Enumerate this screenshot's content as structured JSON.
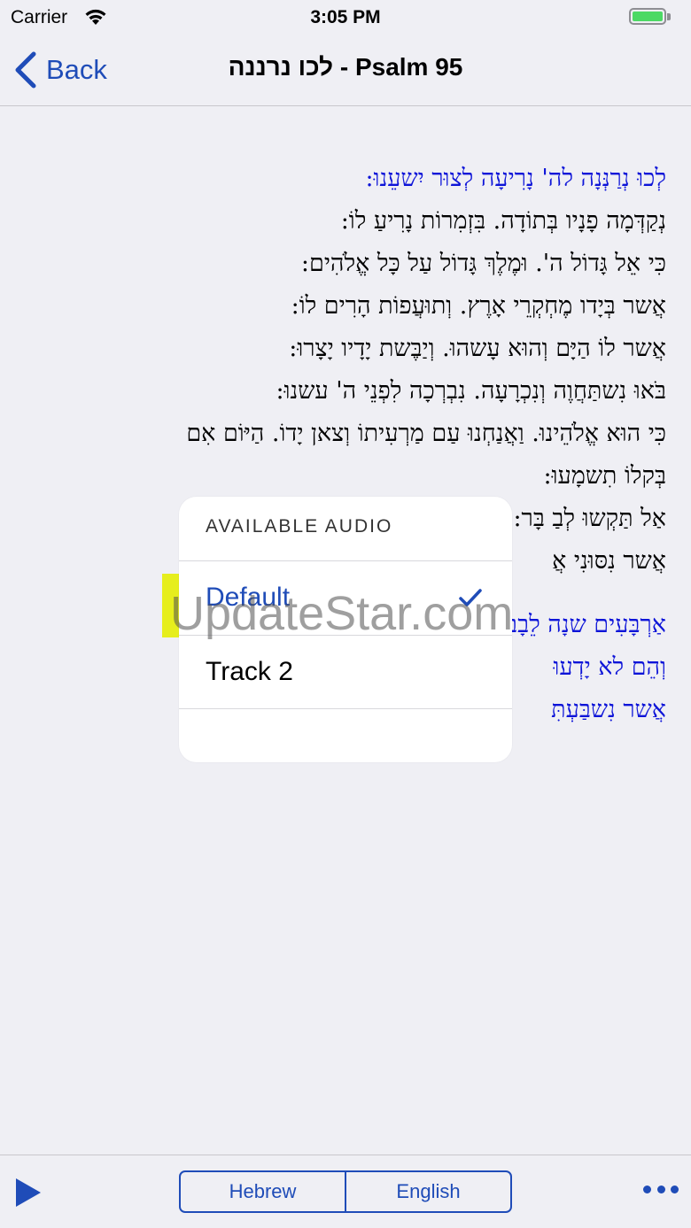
{
  "status_bar": {
    "carrier": "Carrier",
    "time": "3:05 PM",
    "battery_level": 1.0
  },
  "nav": {
    "back_label": "Back",
    "title": "לכו נרננה - Psalm 95"
  },
  "psalm": {
    "lines": [
      {
        "text": "לְכוּ נְרַנְּנָה לה' נָרִיעָה לְצוּר יִשעֵנוּ:",
        "highlighted": true
      },
      {
        "text": "נְקַדְּמָה פָנָיו בְּתוֹדָה. בִּזְמִרוֹת נָרִיעַ לוֹ:",
        "highlighted": false
      },
      {
        "text": "כִּי אֵל גָּדוֹל ה'. וּמֶלֶךְ גָּדוֹל עַל כָּל אֱלֹהִים:",
        "highlighted": false
      },
      {
        "text": "אֲשר בְּיָדו מֶחְקְרֵי אָרֶץ. וְתוּעֲפוֹת הָרִים לוֹ:",
        "highlighted": false
      },
      {
        "text": "אֲשר לוֹ הַיָּם וְהוּא עָשהוּ. וְיַבֶּשת יָדָיו יָצָרוּ:",
        "highlighted": false
      },
      {
        "text": "בֹּאוּ נִשתַּחֲוֶה וְנִכְרָעָה. נִבְרְכָה לִפְנֵי ה' עשנוּ:",
        "highlighted": false
      },
      {
        "text": "כִּי הוּא אֱלֹהֵינוּ. וַאֲנַחְנוּ עַם מַרְעִיתוֹ וְצאן יָדוֹ. הַיּוֹם אִם",
        "highlighted": false
      },
      {
        "text": "בְּקלוֹ תִשמָעוּ:",
        "highlighted": false
      },
      {
        "text": "אַל תַּקְשוּ לְבַ                                               בָּר:",
        "highlighted": false
      },
      {
        "text": "אֲשר נִסּוּנִי אֲ",
        "highlighted": false
      }
    ],
    "lines_after_gap": [
      {
        "text": "אַרְבָּעִים שנָה                                         לֵבָב הֵם.",
        "highlighted": true
      },
      {
        "text": "וְהֵם לא יָדְעוּ",
        "highlighted": true
      },
      {
        "text": "אֲשר נִשבַּעְתִּ",
        "highlighted": true
      }
    ]
  },
  "audio_popover": {
    "header": "AVAILABLE AUDIO",
    "options": [
      {
        "label": "Default",
        "selected": true
      },
      {
        "label": "Track 2",
        "selected": false
      }
    ]
  },
  "watermark": "UpdateStar.com",
  "toolbar": {
    "segments": [
      "Hebrew",
      "English"
    ],
    "play_icon": "play-icon",
    "more_icon": "more-icon"
  },
  "colors": {
    "accent": "#1f4cb8",
    "highlight_text": "#0d14d8",
    "highlight_marker": "#e6ee1d"
  }
}
